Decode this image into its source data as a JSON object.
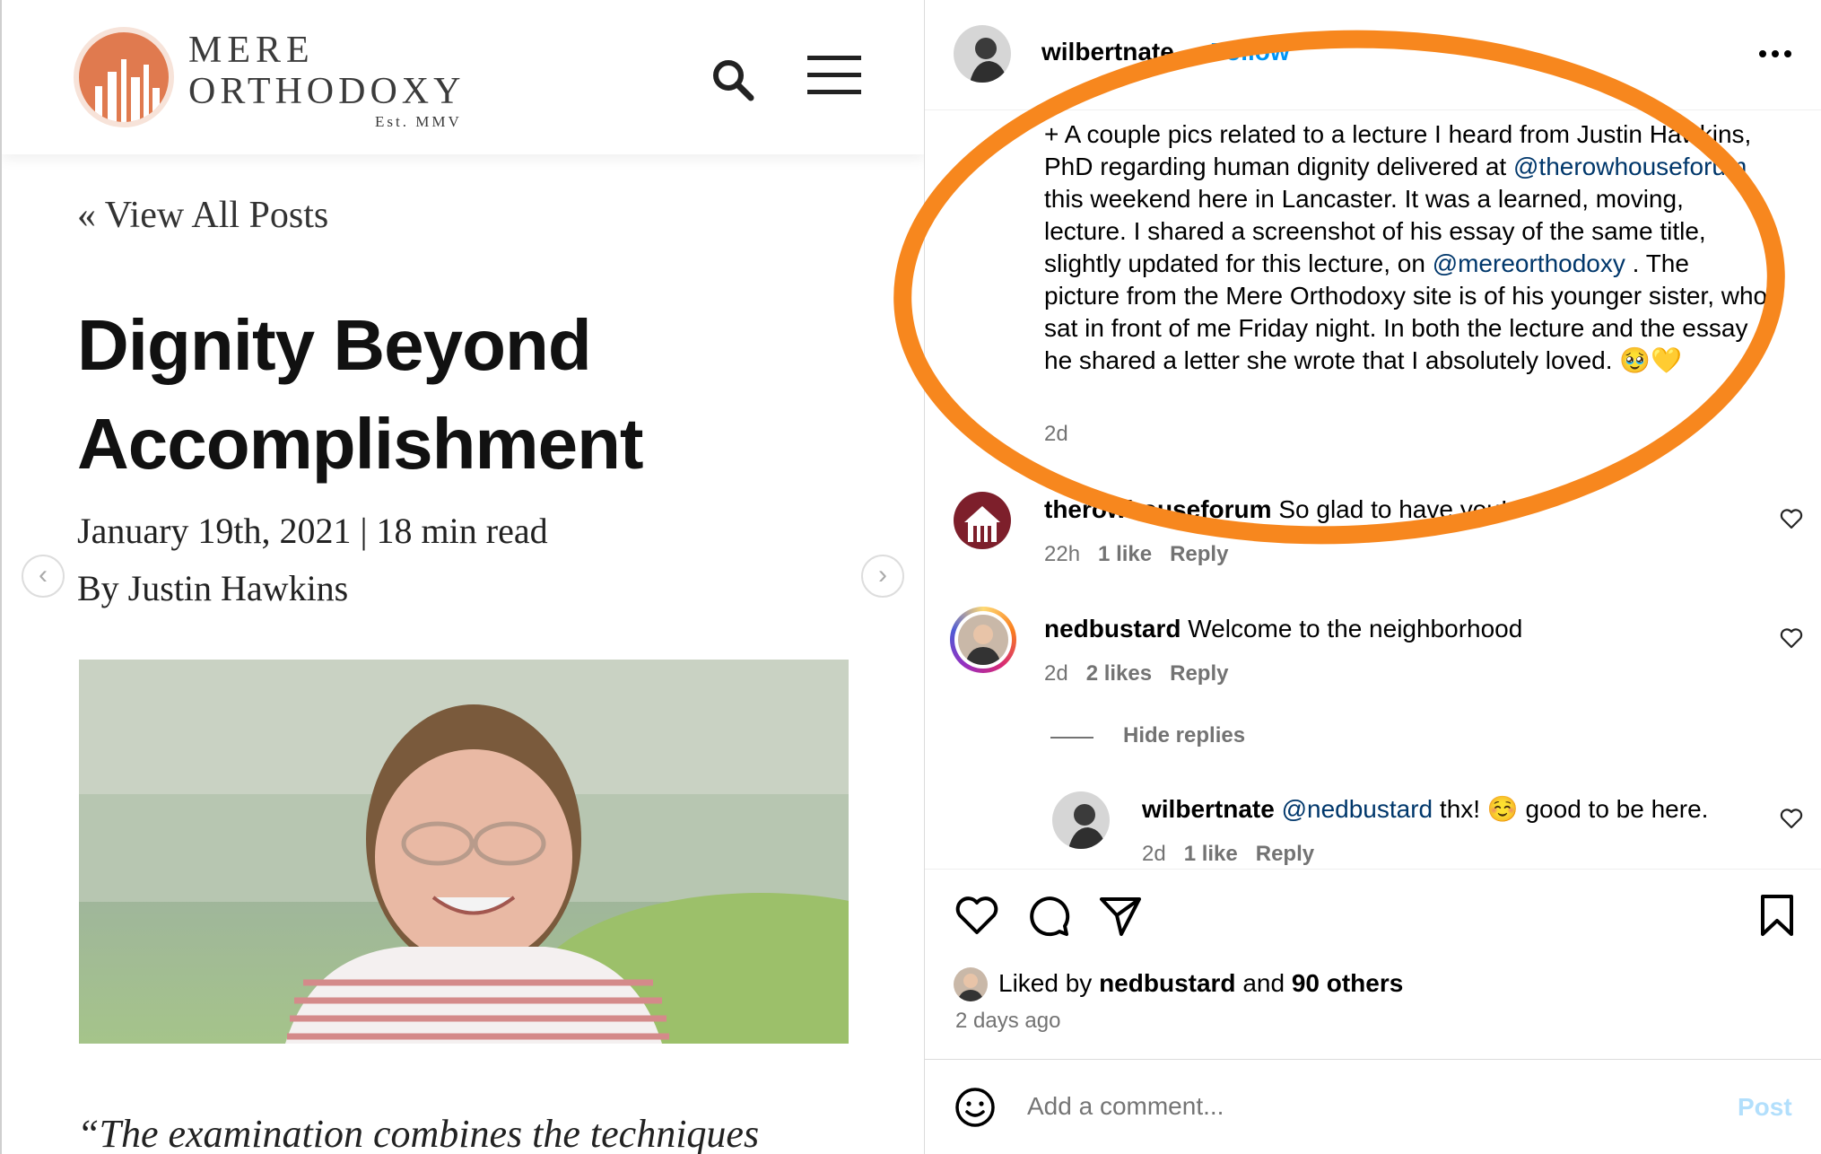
{
  "article": {
    "logo": {
      "line1": "MERE",
      "line2": "ORTHODOXY",
      "est": "Est. MMV"
    },
    "back_link": "«  View All Posts",
    "title_line1": "Dignity Beyond",
    "title_line2": "Accomplishment",
    "date_meta": "January 19th, 2021 | 18 min read",
    "byline": "By Justin Hawkins",
    "prev_arrow": "‹",
    "next_arrow": "›",
    "quote_start": "“The examination combines the techniques"
  },
  "post": {
    "username": "wilbertnate",
    "follow_label": "Follow",
    "caption": {
      "part1": "+ A couple pics related to a lecture I heard from Justin Hawkins, PhD regarding human dignity delivered at ",
      "mention1": "@therowhouseforum",
      "part2": " this weekend here in Lancaster. It was a learned, moving, lecture. I shared a screenshot of his essay of the same title, slightly updated for this lecture, on ",
      "mention2": "@mereorthodoxy",
      "part3": " . The picture from the Mere Orthodoxy site is of his younger sister, who sat in front of me Friday night. In both the lecture and the essay he shared a letter she wrote that I absolutely loved. 🥹💛",
      "time": "2d"
    },
    "comments": [
      {
        "user": "therowhouseforum",
        "text": "So glad to have you!",
        "time": "22h",
        "likes": "1 like",
        "reply": "Reply"
      },
      {
        "user": "nedbustard",
        "text": "Welcome to the neighborhood",
        "time": "2d",
        "likes": "2 likes",
        "reply": "Reply"
      }
    ],
    "hide_replies": "Hide replies",
    "reply": {
      "user": "wilbertnate",
      "mention": "@nedbustard",
      "text": " thx! ☺️ good to be here.",
      "time": "2d",
      "likes": "1 like",
      "reply": "Reply"
    },
    "liked_by": {
      "prefix": "Liked by ",
      "user": "nedbustard",
      "mid": " and ",
      "others": "90 others"
    },
    "post_time": "2 days ago",
    "add_comment_placeholder": "Add a comment...",
    "post_button": "Post"
  },
  "colors": {
    "accent_orange": "#f7871e",
    "ig_blue": "#0095f6",
    "mention": "#00376b",
    "logo": "#e07a4f"
  },
  "icons": [
    "search-icon",
    "menu-icon",
    "more-icon",
    "heart-icon",
    "comment-icon",
    "share-icon",
    "bookmark-icon",
    "emoji-icon"
  ]
}
